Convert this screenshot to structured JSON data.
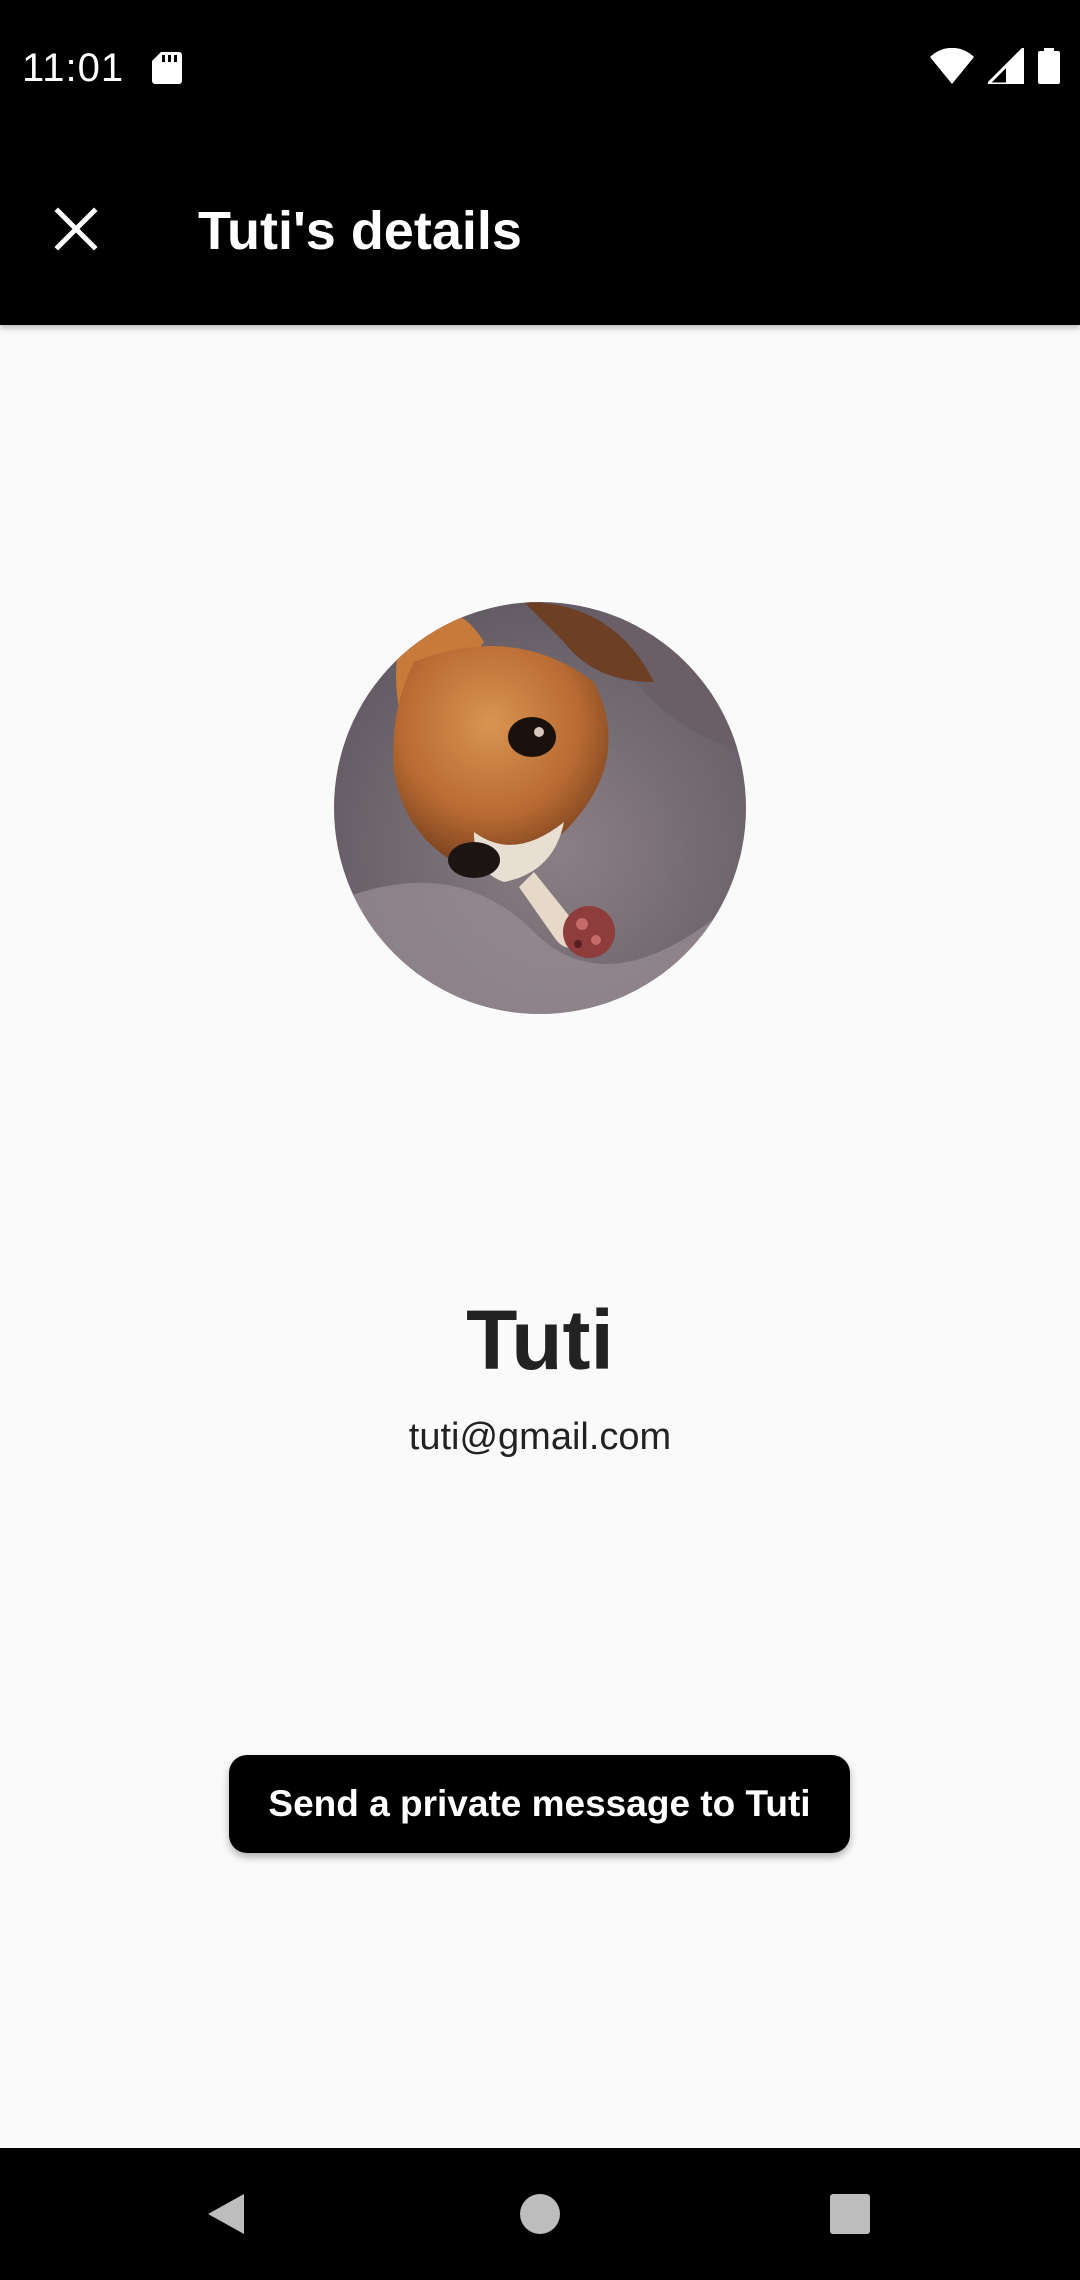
{
  "status_bar": {
    "time": "11:01",
    "icons": [
      "sd-card-icon",
      "wifi-icon",
      "cell-signal-icon",
      "battery-icon"
    ]
  },
  "app_bar": {
    "title": "Tuti's details",
    "close_icon": "close-icon"
  },
  "profile": {
    "name": "Tuti",
    "email": "tuti@gmail.com",
    "avatar": "dog-photo-avatar"
  },
  "actions": {
    "private_message_label": "Send a private message to Tuti"
  },
  "nav_bar": {
    "icons": [
      "back-icon",
      "home-icon",
      "recents-icon"
    ]
  },
  "colors": {
    "bar_background": "#000000",
    "page_background": "#fafafa",
    "text_primary": "#222222",
    "button_background": "#000000",
    "button_text": "#ffffff"
  }
}
